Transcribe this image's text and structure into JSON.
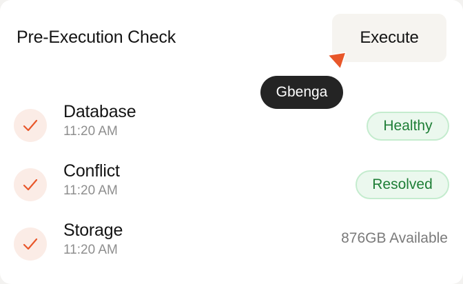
{
  "header": {
    "title": "Pre-Execution Check",
    "execute_label": "Execute"
  },
  "tooltip": {
    "text": "Gbenga"
  },
  "checks": [
    {
      "name": "Database",
      "time": "11:20 AM",
      "status": "Healthy",
      "status_style": "badge"
    },
    {
      "name": "Conflict",
      "time": "11:20 AM",
      "status": "Resolved",
      "status_style": "badge"
    },
    {
      "name": "Storage",
      "time": "11:20 AM",
      "status": "876GB Available",
      "status_style": "plain"
    }
  ],
  "colors": {
    "accent": "#e8572a",
    "success_text": "#1e7e36",
    "success_bg": "#ebf8ee",
    "tooltip_bg": "#242424"
  },
  "icons": {
    "check": "check-icon",
    "cursor": "pointer-cursor-icon"
  }
}
